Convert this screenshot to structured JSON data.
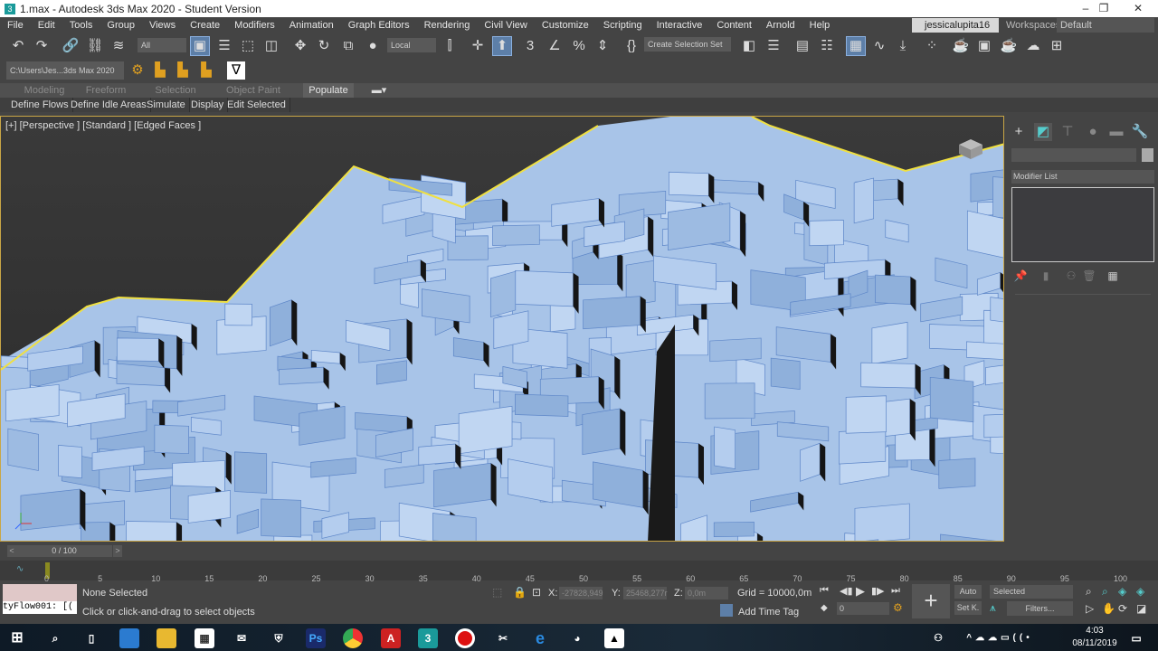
{
  "window": {
    "title": "1.max - Autodesk 3ds Max 2020 - Student Version",
    "app_icon": "3"
  },
  "menu": [
    "File",
    "Edit",
    "Tools",
    "Group",
    "Views",
    "Create",
    "Modifiers",
    "Animation",
    "Graph Editors",
    "Rendering",
    "Civil View",
    "Customize",
    "Scripting",
    "Interactive",
    "Content",
    "Arnold",
    "Help"
  ],
  "user": "jessicalupita16",
  "workspaces_label": "Workspaces:",
  "workspace": "Default",
  "toolbar": {
    "selection_filter": "All",
    "ref_coord": "Local",
    "selection_set": "Create Selection Set"
  },
  "project_path": "C:\\Users\\Jes...3ds Max 2020",
  "ribbon": {
    "tabs": [
      "Modeling",
      "Freeform",
      "Selection",
      "Object Paint",
      "Populate"
    ],
    "active_tab": "Populate",
    "buttons": [
      "Define Flows",
      "Define Idle Areas",
      "Simulate",
      "Display",
      "Edit Selected"
    ]
  },
  "viewport": {
    "label": "[+] [Perspective ] [Standard ] [Edged Faces ]"
  },
  "command_panel": {
    "modifier_list": "Modifier List"
  },
  "timeline": {
    "frame": "0 / 100",
    "ticks": [
      "0",
      "5",
      "10",
      "15",
      "20",
      "25",
      "30",
      "35",
      "40",
      "45",
      "50",
      "55",
      "60",
      "65",
      "70",
      "75",
      "80",
      "85",
      "90",
      "95",
      "100"
    ]
  },
  "status": {
    "script_listener": "tyFlow001: [(",
    "selection": "None Selected",
    "prompt": "Click or click-and-drag to select objects",
    "x_label": "X:",
    "x": "-27828,949",
    "y_label": "Y:",
    "y": "25468,277r",
    "z_label": "Z:",
    "z": "0,0m",
    "grid": "Grid = 10000,0m",
    "add_time_tag": "Add Time Tag",
    "current_frame": "0",
    "auto": "Auto",
    "set_key": "Set K.",
    "key_filter": "Selected",
    "filters": "Filters..."
  },
  "taskbar": {
    "time": "4:03",
    "date": "08/11/2019"
  },
  "colors": {
    "selection": "#f0e040",
    "mesh": "#a8c4e8",
    "accent": "#5d7fa8"
  }
}
